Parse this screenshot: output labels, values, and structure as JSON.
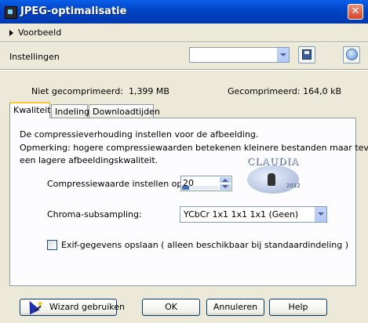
{
  "window": {
    "title": "JPEG-optimalisatie",
    "close_glyph": "✕"
  },
  "preview": {
    "label": "Voorbeeld"
  },
  "settings": {
    "label": "Instellingen",
    "combo_value": ""
  },
  "stats": {
    "uncompressed_label": "Niet gecomprimeerd:",
    "uncompressed_value": "1,399 MB",
    "compressed_label": "Gecomprimeerd:",
    "compressed_value": "164,0 kB"
  },
  "tabs": [
    {
      "label": "Kwaliteit",
      "active": true
    },
    {
      "label": "Indeling",
      "active": false
    },
    {
      "label": "Downloadtijden",
      "active": false
    }
  ],
  "quality": {
    "description": "De compressieverhouding instellen voor de afbeelding.",
    "note_line1": "Opmerking:  hogere compressiewaarden betekenen kleinere bestanden maar tevens",
    "note_line2": "een lagere afbeeldingskwaliteit.",
    "compression_label": "Compressiewaarde instellen op:",
    "compression_value": "20",
    "compression_fraction": 0.2,
    "chroma_label": "Chroma-subsampling:",
    "chroma_value": "YCbCr  1x1  1x1  1x1  (Geen)",
    "exif_label": "Exif-gegevens opslaan ( alleen beschikbaar bij standaardindeling )",
    "exif_checked": false
  },
  "watermark": {
    "text": "CLAUDIA",
    "year": "2012"
  },
  "buttons": {
    "wizard": "Wizard gebruiken",
    "ok": "OK",
    "cancel": "Annuleren",
    "help": "Help"
  },
  "colors": {
    "titlebar": "#0A5FE8",
    "tab_highlight": "#FFC83C",
    "dialog_bg": "#ECE9D8"
  },
  "icons": {
    "app": "app-icon",
    "close": "close-icon",
    "expand": "triangle-right-icon",
    "dropdown": "chevron-down-icon",
    "save": "floppy-disk-icon",
    "reset": "reset-icon",
    "wizard": "wizard-hat-icon"
  }
}
